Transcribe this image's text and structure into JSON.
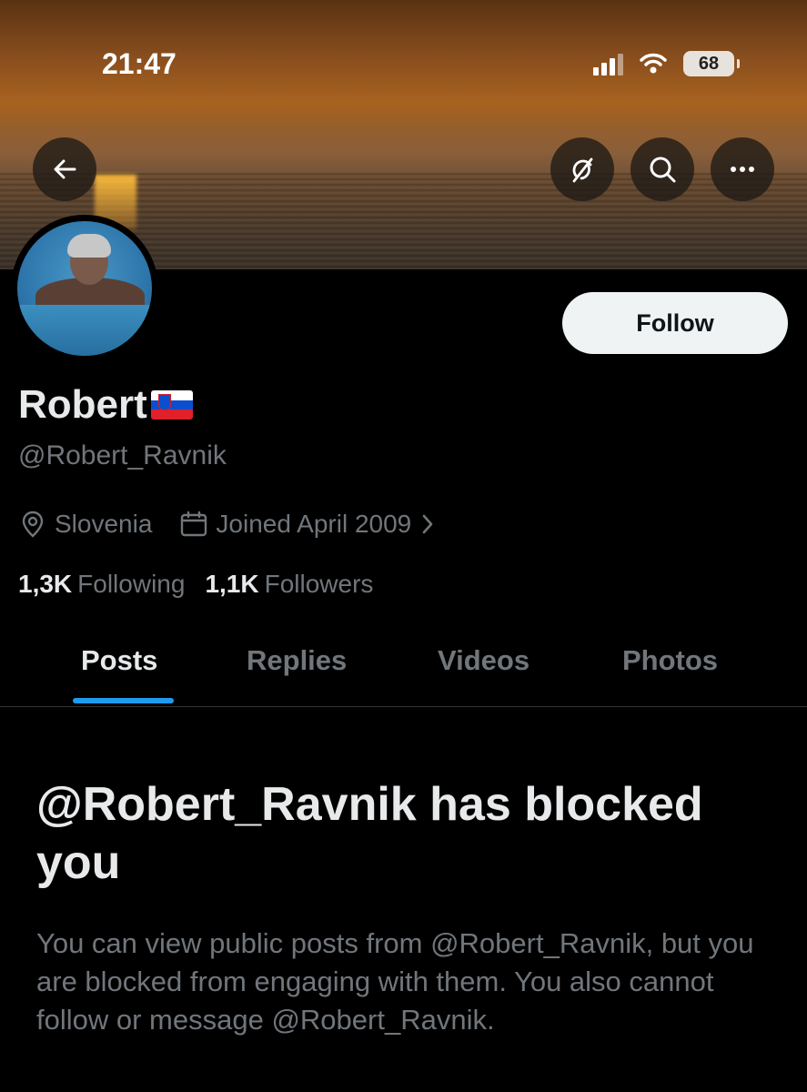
{
  "status_bar": {
    "time": "21:47",
    "battery": "68"
  },
  "colors": {
    "accent": "#1d9bf0",
    "muted_text": "#71767b",
    "primary_text": "#e7e9ea",
    "background": "#000000",
    "follow_bg": "#eff3f4"
  },
  "header": {
    "back_icon": "arrow-left-icon",
    "grok_icon": "grok-icon",
    "search_icon": "search-icon",
    "more_icon": "more-icon",
    "follow_label": "Follow"
  },
  "profile": {
    "display_name": "Robert",
    "flag": "slovenia-flag-icon",
    "handle": "@Robert_Ravnik",
    "location": "Slovenia",
    "joined": "Joined April 2009",
    "following_count": "1,3K",
    "following_label": "Following",
    "followers_count": "1,1K",
    "followers_label": "Followers"
  },
  "tabs": [
    {
      "label": "Posts",
      "active": true
    },
    {
      "label": "Replies",
      "active": false
    },
    {
      "label": "Videos",
      "active": false
    },
    {
      "label": "Photos",
      "active": false
    }
  ],
  "blocked": {
    "title": "@Robert_Ravnik has blocked you",
    "message": "You can view public posts from @Robert_Ravnik, but you are blocked from engaging with them. You also cannot follow or message @Robert_Ravnik."
  }
}
